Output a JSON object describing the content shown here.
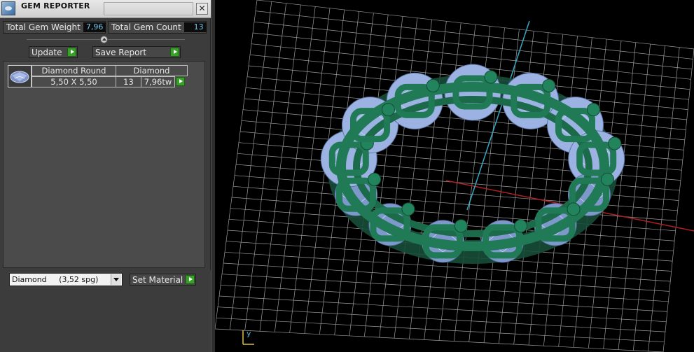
{
  "window": {
    "title": "GEM REPORTER",
    "close_label": "✕"
  },
  "stats": {
    "total_weight_label": "Total Gem Weight",
    "total_weight_value": "7,96",
    "total_count_label": "Total Gem Count",
    "total_count_value": "13"
  },
  "toolbar": {
    "update_label": "Update",
    "save_report_label": "Save Report"
  },
  "gem_list": {
    "rows": [
      {
        "shape": "Diamond Round",
        "material": "Diamond",
        "size": "5,50 X 5,50",
        "count": "13",
        "weight": "7,96tw"
      }
    ]
  },
  "material_select": {
    "value": "Diamond     (3,52 spg)"
  },
  "set_material_label": "Set Material",
  "viewport": {
    "axis_label": "y",
    "colors": {
      "grid": "#d0d0d0",
      "metal": "#1f7a55",
      "stone": "#8aa6d8",
      "x_axis": "#b02020",
      "y_axis": "#3aa7c0"
    }
  }
}
